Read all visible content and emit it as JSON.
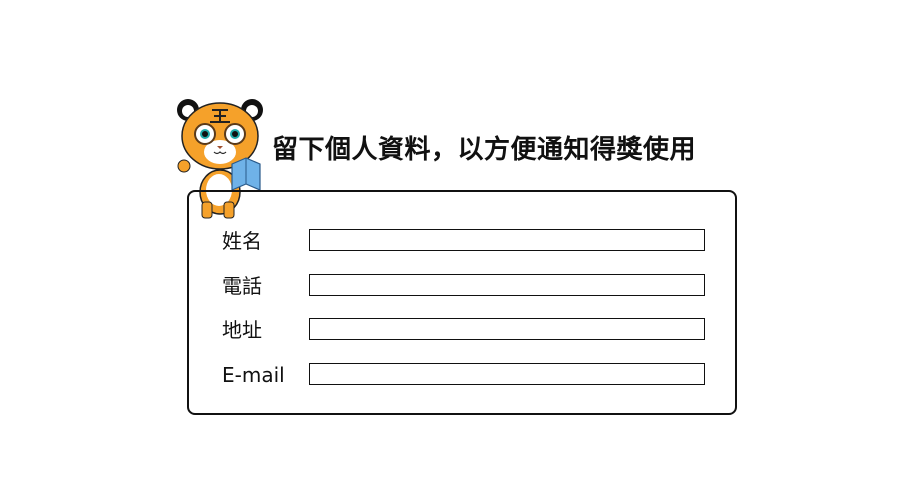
{
  "header": {
    "title": "留下個人資料，以方便通知得獎使用"
  },
  "form": {
    "fields": [
      {
        "label": "姓名",
        "value": ""
      },
      {
        "label": "電話",
        "value": ""
      },
      {
        "label": "地址",
        "value": ""
      },
      {
        "label": "E-mail",
        "value": ""
      }
    ]
  },
  "colors": {
    "tiger": "#f5a12a",
    "book": "#6fb2e8",
    "border": "#111111"
  }
}
